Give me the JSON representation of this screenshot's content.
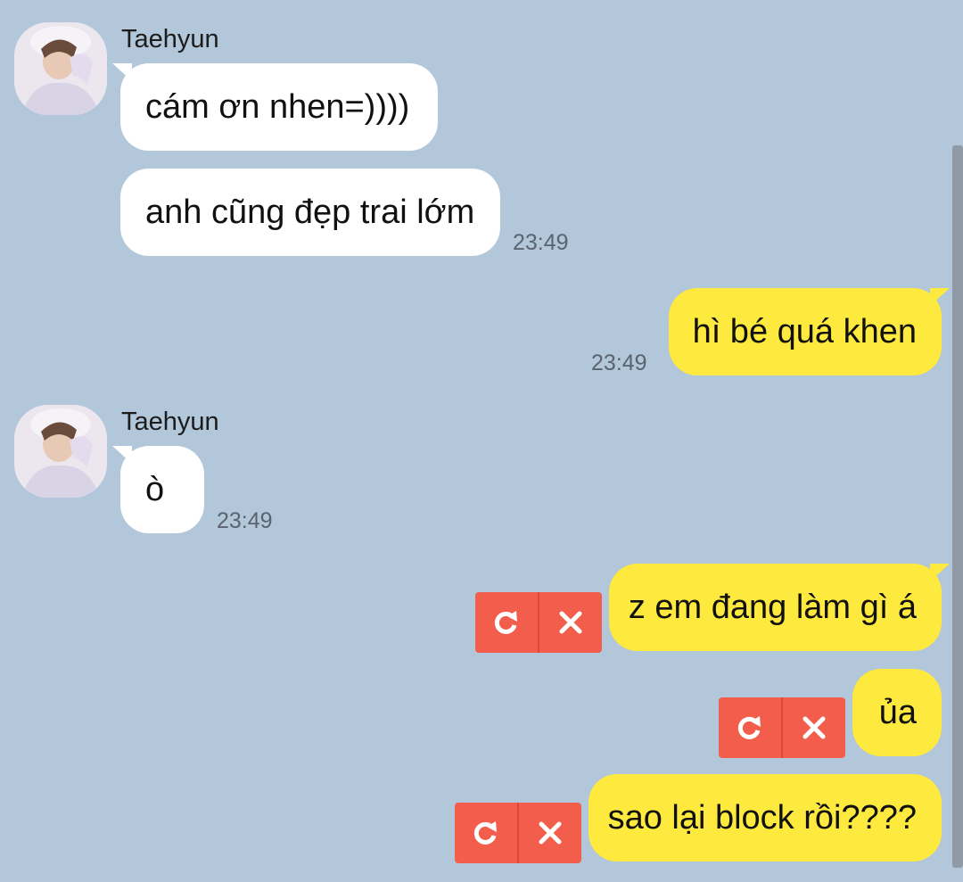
{
  "chat": {
    "messages": [
      {
        "sender": "Taehyun",
        "text": "cám ơn nhen=))))"
      },
      {
        "text": "anh cũng đẹp trai lớm",
        "time": "23:49"
      },
      {
        "text": "hì bé quá khen",
        "time": "23:49"
      },
      {
        "sender": "Taehyun",
        "text": "ò",
        "time": "23:49"
      },
      {
        "text": "z em đang làm gì á"
      },
      {
        "text": "ủa"
      },
      {
        "text": "sao lại block rồi????"
      }
    ]
  },
  "icons": {
    "retry": "retry-icon",
    "delete": "close-icon"
  },
  "colors": {
    "background": "#b2c7d9",
    "incoming_bubble": "#ffffff",
    "outgoing_bubble": "#fee93f",
    "failed_action": "#f35e4c"
  }
}
